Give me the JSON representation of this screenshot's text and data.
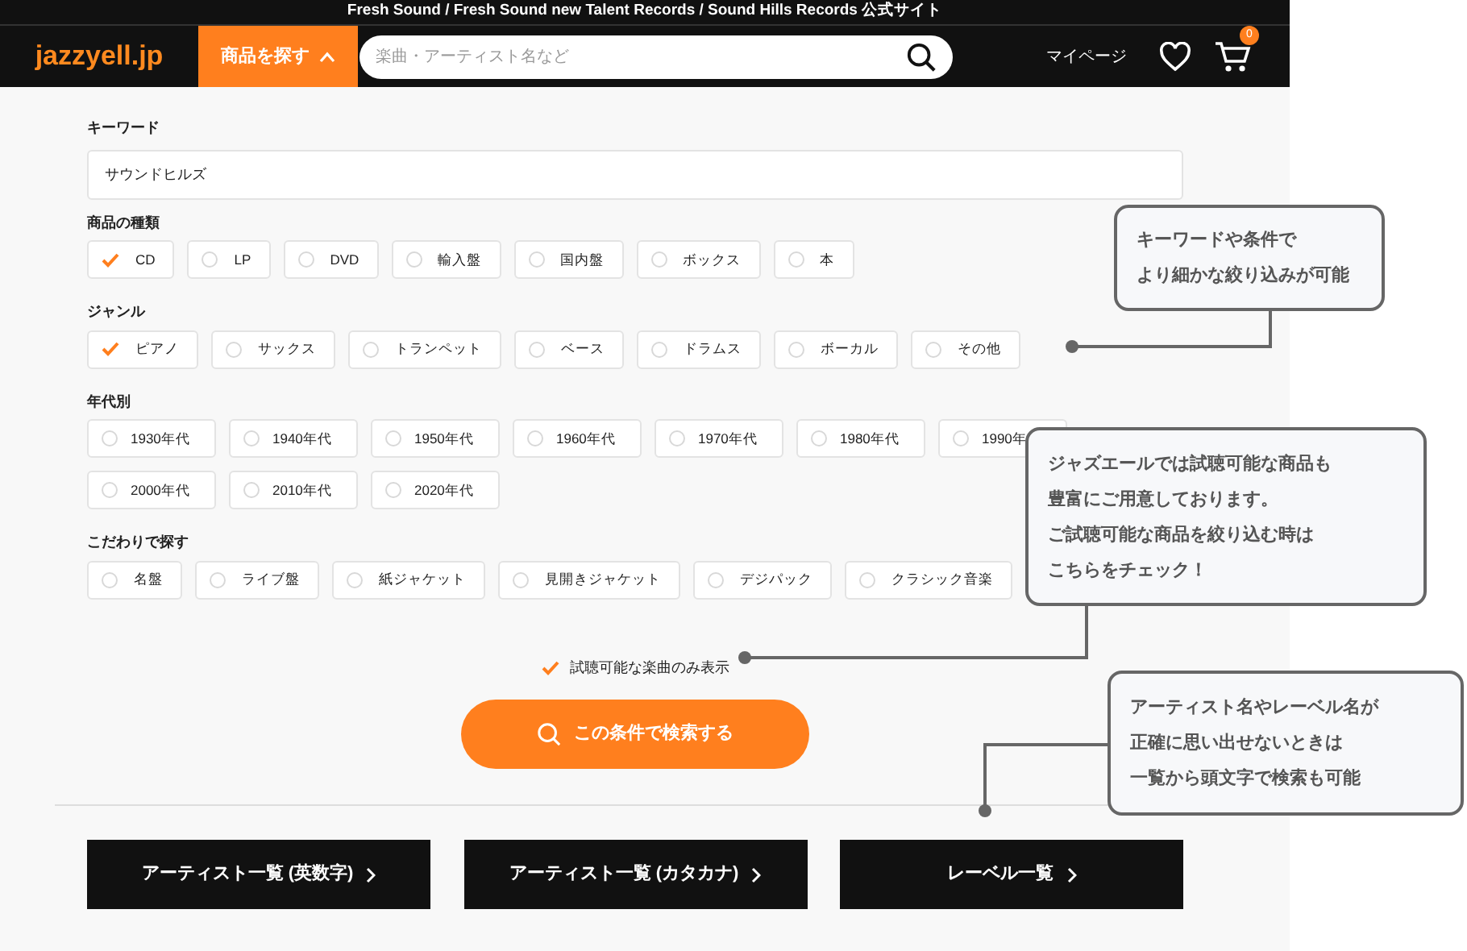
{
  "header": {
    "tagline": "Fresh Sound / Fresh Sound new Talent Records / Sound Hills Records 公式サイト",
    "logo": "jazzyell.jp",
    "browse_button": "商品を探す",
    "search": {
      "placeholder": "楽曲・アーティスト名など"
    },
    "mypage": "マイページ",
    "cart_count": "0"
  },
  "keyword": {
    "label": "キーワード",
    "value": "サウンドヒルズ"
  },
  "filter_groups": [
    {
      "label": "商品の種類",
      "kind": "auto",
      "options": [
        {
          "label": "CD",
          "checked": true
        },
        {
          "label": "LP",
          "checked": false
        },
        {
          "label": "DVD",
          "checked": false
        },
        {
          "label": "輸入盤",
          "checked": false
        },
        {
          "label": "国内盤",
          "checked": false
        },
        {
          "label": "ボックス",
          "checked": false
        },
        {
          "label": "本",
          "checked": false
        }
      ]
    },
    {
      "label": "ジャンル",
      "kind": "auto",
      "options": [
        {
          "label": "ピアノ",
          "checked": true
        },
        {
          "label": "サックス",
          "checked": false
        },
        {
          "label": "トランペット",
          "checked": false
        },
        {
          "label": "ベース",
          "checked": false
        },
        {
          "label": "ドラムス",
          "checked": false
        },
        {
          "label": "ボーカル",
          "checked": false
        },
        {
          "label": "その他",
          "checked": false
        }
      ]
    },
    {
      "label": "年代別",
      "kind": "fixed",
      "options": [
        {
          "label": "1930年代",
          "checked": false
        },
        {
          "label": "1940年代",
          "checked": false
        },
        {
          "label": "1950年代",
          "checked": false
        },
        {
          "label": "1960年代",
          "checked": false
        },
        {
          "label": "1970年代",
          "checked": false
        },
        {
          "label": "1980年代",
          "checked": false
        },
        {
          "label": "1990年",
          "checked": false
        },
        {
          "label": "2000年代",
          "checked": false
        },
        {
          "label": "2010年代",
          "checked": false
        },
        {
          "label": "2020年代",
          "checked": false
        }
      ]
    },
    {
      "label": "こだわりで探す",
      "kind": "auto",
      "options": [
        {
          "label": "名盤",
          "checked": false
        },
        {
          "label": "ライブ盤",
          "checked": false
        },
        {
          "label": "紙ジャケット",
          "checked": false
        },
        {
          "label": "見開きジャケット",
          "checked": false
        },
        {
          "label": "デジパック",
          "checked": false
        },
        {
          "label": "クラシック音楽",
          "checked": false
        }
      ]
    }
  ],
  "listenable_only": {
    "label": "試聴可能な楽曲のみ表示",
    "checked": true
  },
  "search_button": "この条件で検索する",
  "index_buttons": [
    "アーティスト一覧 (英数字)",
    "アーティスト一覧 (カタカナ)",
    "レーベル一覧"
  ],
  "callouts": [
    {
      "lines": [
        "キーワードや条件で",
        "より細かな絞り込みが可能"
      ]
    },
    {
      "lines": [
        "ジャズエールでは試聴可能な商品も",
        "豊富にご用意しております。",
        "ご試聴可能な商品を絞り込む時は",
        "こちらをチェック！"
      ]
    },
    {
      "lines": [
        "アーティスト名やレーベル名が",
        "正確に思い出せないときは",
        "一覧から頭文字で検索も可能"
      ]
    }
  ]
}
